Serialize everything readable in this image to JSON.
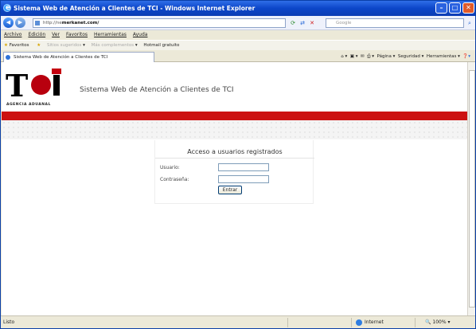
{
  "window": {
    "title": "Sistema Web de Atención a Clientes de TCI - Windows Internet Explorer"
  },
  "address": {
    "url_prefix": "http://ne",
    "url_domain": "merkanet.com/",
    "search_placeholder": "Google"
  },
  "menu": [
    "Archivo",
    "Edición",
    "Ver",
    "Favoritos",
    "Herramientas",
    "Ayuda"
  ],
  "favbar": {
    "label": "Favoritos",
    "item1": "Sitios sugeridos",
    "item2": "Más complementos",
    "item3": "Hotmail gratuito"
  },
  "tab": {
    "label": "Sistema Web de Atención a Clientes de TCI"
  },
  "commands": {
    "pagina": "Página",
    "seguridad": "Seguridad",
    "herramientas": "Herramientas"
  },
  "page": {
    "logo_sub": "AGENCIA ADUANAL",
    "system_title": "Sistema Web de Atención a Clientes de TCI",
    "login": {
      "title": "Acceso a usuarios registrados",
      "user_label": "Usuario:",
      "pass_label": "Contraseña:",
      "submit": "Entrar"
    }
  },
  "status": {
    "text": "Listo",
    "zone": "Internet",
    "zoom": "100%"
  },
  "colors": {
    "brand_red": "#cc1111",
    "titlebar": "#0c46c8"
  }
}
